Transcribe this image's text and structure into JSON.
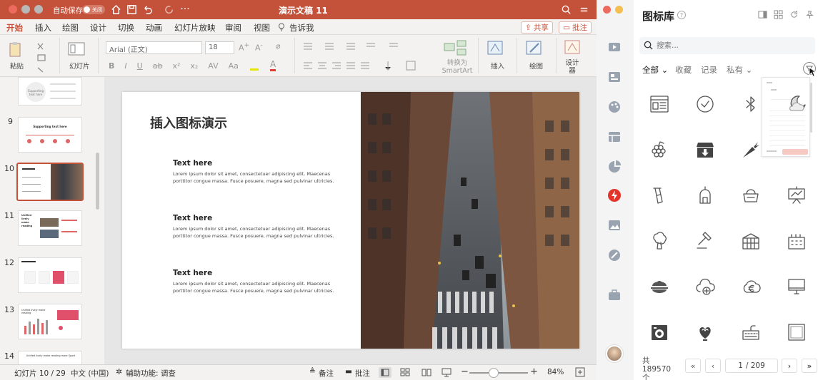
{
  "titlebar": {
    "autosave_label": "自动保存",
    "autosave_state": "关闭",
    "doc_title": "演示文稿 11"
  },
  "tabs": [
    "开始",
    "插入",
    "绘图",
    "设计",
    "切换",
    "动画",
    "幻灯片放映",
    "审阅",
    "视图",
    "告诉我"
  ],
  "share_label": "共享",
  "comment_label": "批注",
  "ribbon": {
    "paste": "粘贴",
    "slide": "幻灯片",
    "font_name": "Arial (正文)",
    "font_size": "18",
    "convert": "转换为 SmartArt",
    "insert": "插入",
    "draw": "绘图",
    "designer": "设计器"
  },
  "thumbs": [
    {
      "num": "",
      "label": "Supporting text here"
    },
    {
      "num": "9",
      "label": "Supporting text here"
    },
    {
      "num": "10",
      "label": ""
    },
    {
      "num": "11",
      "label": "Unified lively make reading"
    },
    {
      "num": "12",
      "label": ""
    },
    {
      "num": "13",
      "label": "Unified lively make reading"
    },
    {
      "num": "14",
      "label": "Unified lively make reading more Sport"
    }
  ],
  "slide": {
    "title": "插入图标演示",
    "blocks": [
      {
        "heading": "Text here",
        "body1": "Lorem ipsum dolor sit amet, consectetuer adipiscing elit. Maecenas",
        "body2": "porttitor congue massa. Fusce posuere, magna sed pulvinar ultricies."
      },
      {
        "heading": "Text here",
        "body1": "Lorem ipsum dolor sit amet, consectetuer adipiscing elit. Maecenas",
        "body2": "porttitor congue massa. Fusce posuere, magna sed pulvinar ultricies."
      },
      {
        "heading": "Text here",
        "body1": "Lorem ipsum dolor sit amet, consectetuer adipiscing elit. Maecenas",
        "body2": "porttitor congue massa. Fusce posuere, magna sed pulvinar ultricies."
      }
    ]
  },
  "status": {
    "slide_pos": "幻灯片 10 / 29",
    "language": "中文 (中国)",
    "accessibility": "辅助功能: 调查",
    "notes": "备注",
    "comments": "批注",
    "zoom": "84%"
  },
  "panel": {
    "title": "图标库",
    "search_placeholder": "搜索...",
    "filters": [
      "全部",
      "收藏",
      "记录",
      "私有"
    ],
    "total_label": "共 189570 个",
    "page_current": "1",
    "page_total": "/ 209"
  },
  "colors": {
    "accent": "#c4513a",
    "share": "#c4513a"
  }
}
